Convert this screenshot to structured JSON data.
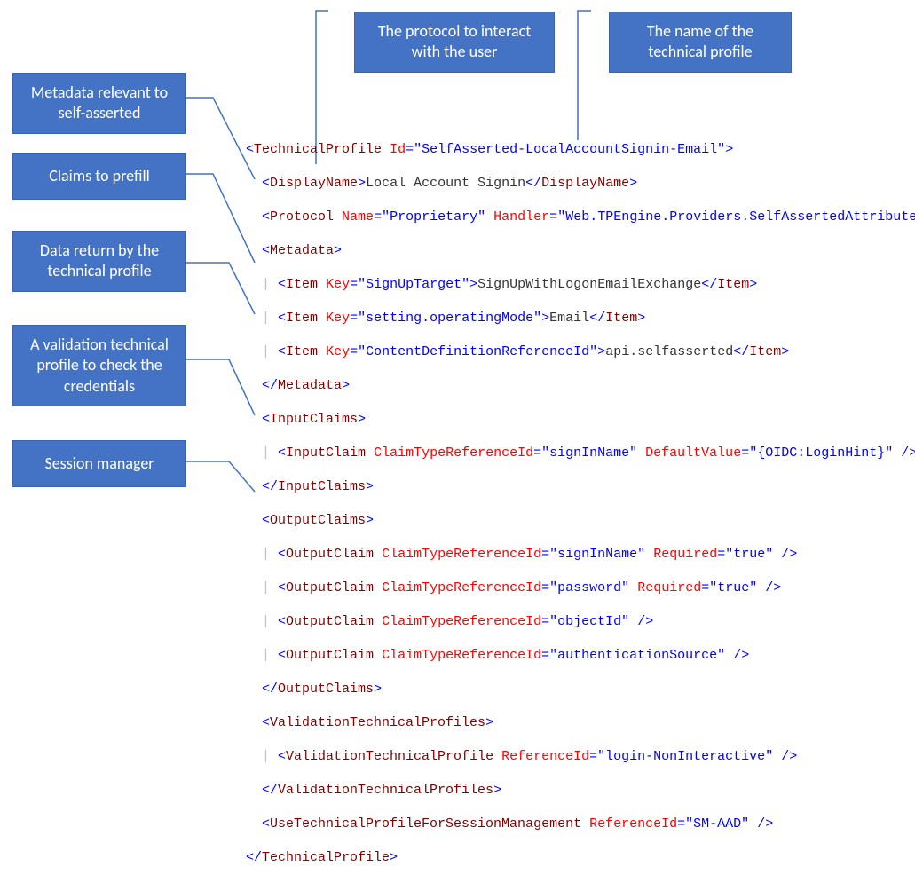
{
  "topCallouts": {
    "protocol": "The protocol to interact with the user",
    "name": "The name of the technical profile"
  },
  "leftCallouts": {
    "metadata": "Metadata relevant to self-asserted",
    "claims": "Claims to prefill",
    "data": "Data return by the technical profile",
    "validation": "A validation technical profile to check the credentials",
    "session": "Session manager"
  },
  "xml": {
    "tp_id": "SelfAsserted-LocalAccountSignin-Email",
    "displayName": "Local Account Signin",
    "protocolName": "Proprietary",
    "protocolHandler": "Web.TPEngine.Providers.SelfAssertedAttributeP",
    "items": {
      "signUpTarget_key": "SignUpTarget",
      "signUpTarget_val": "SignUpWithLogonEmailExchange",
      "operatingMode_key": "setting.operatingMode",
      "operatingMode_val": "Email",
      "contentDef_key": "ContentDefinitionReferenceId",
      "contentDef_val": "api.selfasserted"
    },
    "inputClaim_ref": "signInName",
    "inputClaim_default": "{OIDC:LoginHint}",
    "outputClaims": {
      "c1_ref": "signInName",
      "c1_req": "true",
      "c2_ref": "password",
      "c2_req": "true",
      "c3_ref": "objectId",
      "c4_ref": "authenticationSource"
    },
    "validation_ref": "login-NonInteractive",
    "session_ref": "SM-AAD"
  }
}
